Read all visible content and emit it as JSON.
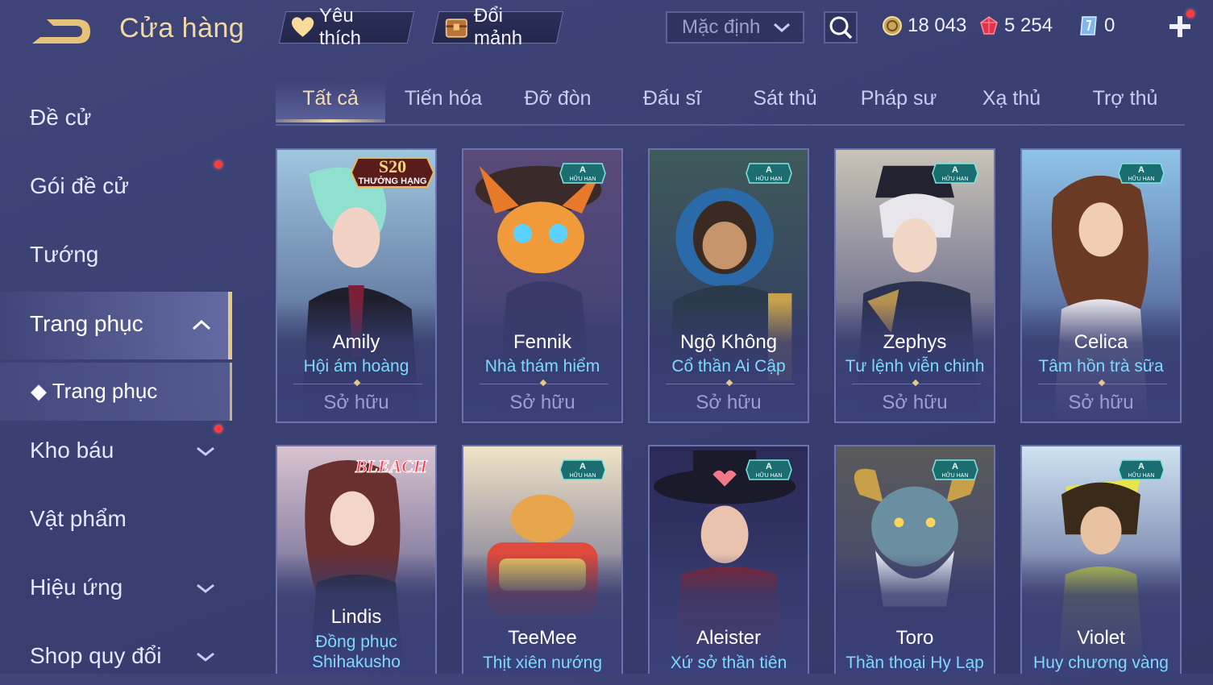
{
  "header": {
    "title": "Cửa hàng",
    "favorites_label": "Yêu thích",
    "exchange_label": "Đổi mảnh",
    "sort_selected": "Mặc định",
    "currencies": {
      "gold": "18 043",
      "ruby": "5 254",
      "voucher": "0"
    }
  },
  "sidebar": {
    "items": [
      {
        "label": "Đề cử"
      },
      {
        "label": "Gói đề cử"
      },
      {
        "label": "Tướng"
      },
      {
        "label": "Trang phục"
      },
      {
        "label": "Trang phục"
      },
      {
        "label": "Kho báu"
      },
      {
        "label": "Vật phẩm"
      },
      {
        "label": "Hiệu ứng"
      },
      {
        "label": "Shop quy đổi"
      }
    ]
  },
  "tabs": [
    "Tất cả",
    "Tiến hóa",
    "Đỡ đòn",
    "Đấu sĩ",
    "Sát thủ",
    "Pháp sư",
    "Xạ thủ",
    "Trợ thủ"
  ],
  "active_tab": "Tất cả",
  "badges": {
    "s20_top": "S20",
    "s20_bottom": "THƯỞNG HẠNG",
    "limited_top": "A",
    "limited_bottom": "HỮU HẠN",
    "bleach": "BLEACH"
  },
  "cards": [
    {
      "hero": "Amily",
      "skin": "Hội ám hoàng",
      "status": "Sở hữu",
      "badge": "s20"
    },
    {
      "hero": "Fennik",
      "skin": "Nhà thám hiểm",
      "status": "Sở hữu",
      "badge": "limited"
    },
    {
      "hero": "Ngộ Không",
      "skin": "Cổ thần Ai Cập",
      "status": "Sở hữu",
      "badge": "limited"
    },
    {
      "hero": "Zephys",
      "skin": "Tư lệnh viễn chinh",
      "status": "Sở hữu",
      "badge": "limited"
    },
    {
      "hero": "Celica",
      "skin": "Tâm hồn trà sữa",
      "status": "Sở hữu",
      "badge": "limited"
    },
    {
      "hero": "Lindis",
      "skin": "Đồng phục",
      "skin2": "Shihakusho",
      "badge": "bleach"
    },
    {
      "hero": "TeeMee",
      "skin": "Thịt xiên nướng",
      "badge": "limited"
    },
    {
      "hero": "Aleister",
      "skin": "Xứ sở thần tiên",
      "badge": "limited"
    },
    {
      "hero": "Toro",
      "skin": "Thần thoại Hy Lạp",
      "badge": "limited"
    },
    {
      "hero": "Violet",
      "skin": "Huy chương vàng",
      "badge": "limited"
    }
  ],
  "colors": {
    "background": "#3a4072",
    "accent_gold": "#e7c987",
    "skin_name": "#7fd8ff",
    "notification": "#ff3b3b"
  }
}
